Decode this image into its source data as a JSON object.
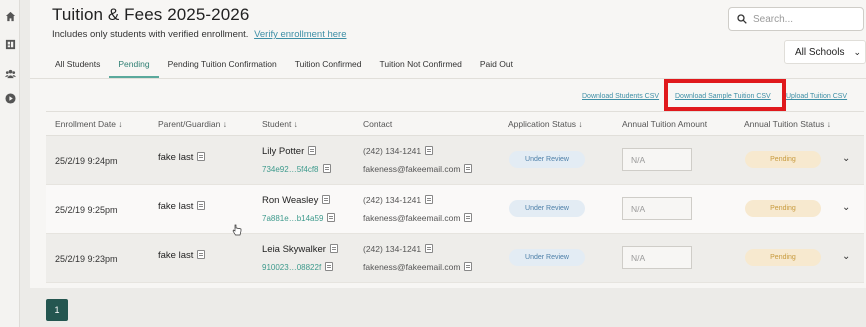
{
  "rail": {
    "icons": [
      "home-icon",
      "dashboard-icon",
      "users-icon",
      "play-icon"
    ]
  },
  "header": {
    "title": "Tuition & Fees 2025-2026",
    "subtitle": "Includes only students with verified enrollment.",
    "subtitle_link": "Verify enrollment here"
  },
  "search": {
    "placeholder": "Search..."
  },
  "school_filter": {
    "selected": "All Schools"
  },
  "tabs": [
    {
      "label": "All Students",
      "active": false
    },
    {
      "label": "Pending",
      "active": true
    },
    {
      "label": "Pending Tuition Confirmation",
      "active": false
    },
    {
      "label": "Tuition Confirmed",
      "active": false
    },
    {
      "label": "Tuition Not Confirmed",
      "active": false
    },
    {
      "label": "Paid Out",
      "active": false
    }
  ],
  "csv": {
    "students": "Download Students CSV",
    "sample": "Download Sample Tuition CSV",
    "upload": "Upload Tuition CSV"
  },
  "table": {
    "headers": {
      "enrollment_date": "Enrollment Date ↓",
      "parent": "Parent/Guardian ↓",
      "student": "Student ↓",
      "contact": "Contact",
      "app_status": "Application Status ↓",
      "tuition_amount": "Annual Tuition Amount",
      "tuition_status": "Annual Tuition Status ↓"
    },
    "rows": [
      {
        "date": "25/2/19 9:24pm",
        "parent": "fake last",
        "student": "Lily Potter",
        "student_id": "734e92…5f4cf8",
        "phone": "(242) 134-1241",
        "email": "fakeness@fakeemail.com",
        "app_status": "Under Review",
        "amount_placeholder": "N/A",
        "tuition_status": "Pending"
      },
      {
        "date": "25/2/19 9:25pm",
        "parent": "fake last",
        "student": "Ron Weasley",
        "student_id": "7a881e…b14a59",
        "phone": "(242) 134-1241",
        "email": "fakeness@fakeemail.com",
        "app_status": "Under Review",
        "amount_placeholder": "N/A",
        "tuition_status": "Pending"
      },
      {
        "date": "25/2/19 9:23pm",
        "parent": "fake last",
        "student": "Leia Skywalker",
        "student_id": "910023…08822f",
        "phone": "(242) 134-1241",
        "email": "fakeness@fakeemail.com",
        "app_status": "Under Review",
        "amount_placeholder": "N/A",
        "tuition_status": "Pending"
      }
    ]
  },
  "pagination": {
    "current": "1"
  },
  "colors": {
    "accent": "#2f7f73",
    "highlight": "#e0191c",
    "review_pill": "#e3ecf4",
    "pending_pill": "#f7e9cf"
  }
}
